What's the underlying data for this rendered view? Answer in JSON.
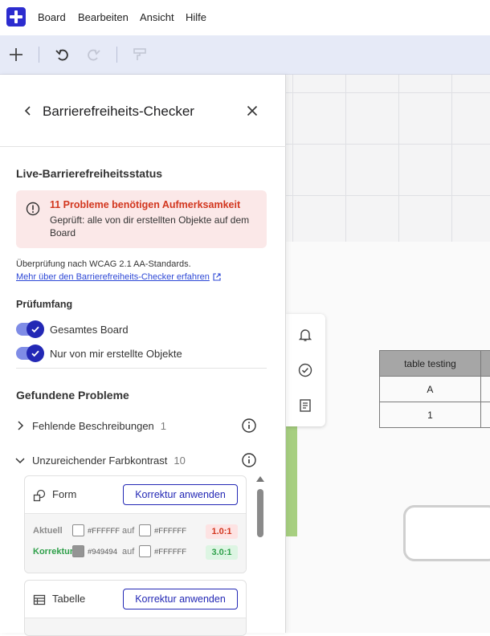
{
  "menubar": {
    "items": [
      "Board",
      "Bearbeiten",
      "Ansicht",
      "Hilfe"
    ]
  },
  "toolbar": {
    "icons": [
      "plus-icon",
      "undo-icon",
      "redo-icon",
      "format-painter-icon"
    ]
  },
  "panel": {
    "title": "Barrierefreiheits-Checker",
    "status_title": "Live-Barrierefreiheitsstatus",
    "alert": {
      "title": "11 Probleme benötigen Aufmerksamkeit",
      "body": "Geprüft: alle von dir erstellten Objekte auf dem Board"
    },
    "wcag_text": "Überprüfung nach WCAG 2.1 AA-Standards.",
    "wcag_link": "Mehr über den Barrierefreiheits-Checker erfahren",
    "scope_title": "Prüfumfang",
    "scope": [
      {
        "label": "Gesamtes Board",
        "checked": true
      },
      {
        "label": "Nur von mir erstellte Objekte",
        "checked": true
      }
    ],
    "problems_title": "Gefundene Probleme",
    "categories": [
      {
        "label": "Fehlende Beschreibungen",
        "count": "1",
        "expanded": false
      },
      {
        "label": "Unzureichender Farbkontrast",
        "count": "10",
        "expanded": true
      }
    ],
    "cards": [
      {
        "title": "Form",
        "button": "Korrektur anwenden",
        "current_label": "Aktuell",
        "current_fg": "#FFFFFF",
        "current_bg": "#FFFFFF",
        "current_ratio": "1.0:1",
        "fix_label": "Korrektur",
        "fix_fg": "#949494",
        "fix_bg": "#FFFFFF",
        "fix_ratio": "3.0:1",
        "auf": "auf"
      },
      {
        "title": "Tabelle",
        "button": "Korrektur anwenden"
      }
    ]
  },
  "board": {
    "table": {
      "header": "table testing",
      "rows": [
        "A",
        "1"
      ]
    },
    "side_tools": [
      "bell-icon",
      "check-circle-icon",
      "notes-icon"
    ]
  },
  "colors": {
    "accent": "#2328b5",
    "alert_bg": "#fbe8e8",
    "alert_text": "#d2361e",
    "bad_ratio_bg": "#fde3e3",
    "good_ratio_bg": "#ddf5e3"
  }
}
